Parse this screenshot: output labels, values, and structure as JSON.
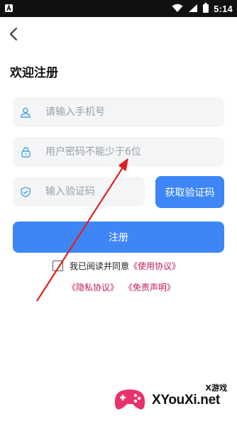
{
  "status_bar": {
    "time": "5:14"
  },
  "page": {
    "title": "欢迎注册"
  },
  "form": {
    "phone_placeholder": "请输入手机号",
    "password_placeholder": "用户密码不能少于6位",
    "code_placeholder": "输入验证码",
    "get_code_label": "获取验证码",
    "register_label": "注册"
  },
  "agreement": {
    "prefix": "我已阅读并同意",
    "terms_link": "《使用协议》",
    "privacy_link": "《隐私协议》",
    "disclaimer_link": "《免责声明》",
    "checked": false
  },
  "watermark": {
    "brand": "XYouXi.net",
    "sub": "X游戏"
  },
  "colors": {
    "primary": "#3e86f5",
    "link": "#c2185b",
    "field_bg": "#f4f5f7",
    "icon_accent": "#4aa3e0",
    "annotation_arrow": "#e02020"
  }
}
